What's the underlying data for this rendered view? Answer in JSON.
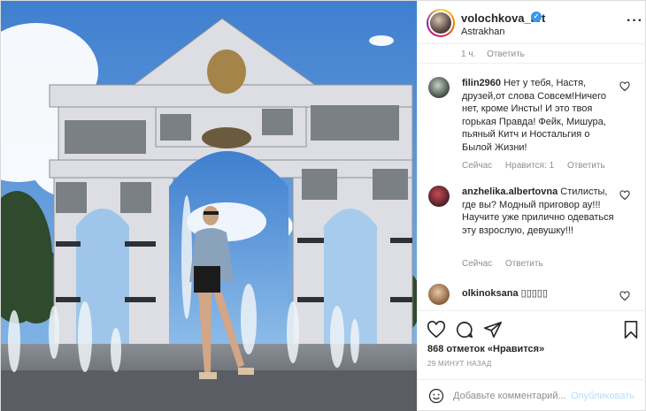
{
  "header": {
    "username": "volochkova_art",
    "location": "Astrakhan",
    "verified_icon": "verified-badge-icon",
    "more_icon": "more-options-icon"
  },
  "caption_meta": {
    "time": "1 ч.",
    "reply": "Ответить"
  },
  "comments": [
    {
      "username": "filin2960",
      "text": "Нет у тебя, Настя, друзей,от слова Совсем!Ничего нет, кроме Инсты! И это твоя горькая Правда! Фейк, Мишура, пьяный Китч и Ностальгия о Былой Жизни!",
      "meta": [
        "Сейчас",
        "Нравится: 1",
        "Ответить"
      ]
    },
    {
      "username": "anzhelika.albertovna",
      "text": "Стилисты, где вы? Модный приговор ау!!! Научите уже прилично одеваться эту взрослую, девушку!!!",
      "meta": [
        "Сейчас",
        "Ответить"
      ]
    },
    {
      "username": "olkinoksana",
      "text": "",
      "meta": []
    }
  ],
  "actions": {
    "like_icon": "heart-icon",
    "comment_icon": "comment-icon",
    "share_icon": "share-icon",
    "save_icon": "bookmark-icon"
  },
  "likes": {
    "count": "868 отметок",
    "label": "«Нравится»"
  },
  "timestamp": "29 МИНУТ НАЗАД",
  "add_comment": {
    "placeholder": "Добавьте комментарий...",
    "publish": "Опубликовать",
    "emoji_icon": "emoji-icon"
  },
  "colors": {
    "verified": "#3897f0",
    "muted": "#8e8e8e",
    "publish_disabled": "#b2dffc"
  }
}
